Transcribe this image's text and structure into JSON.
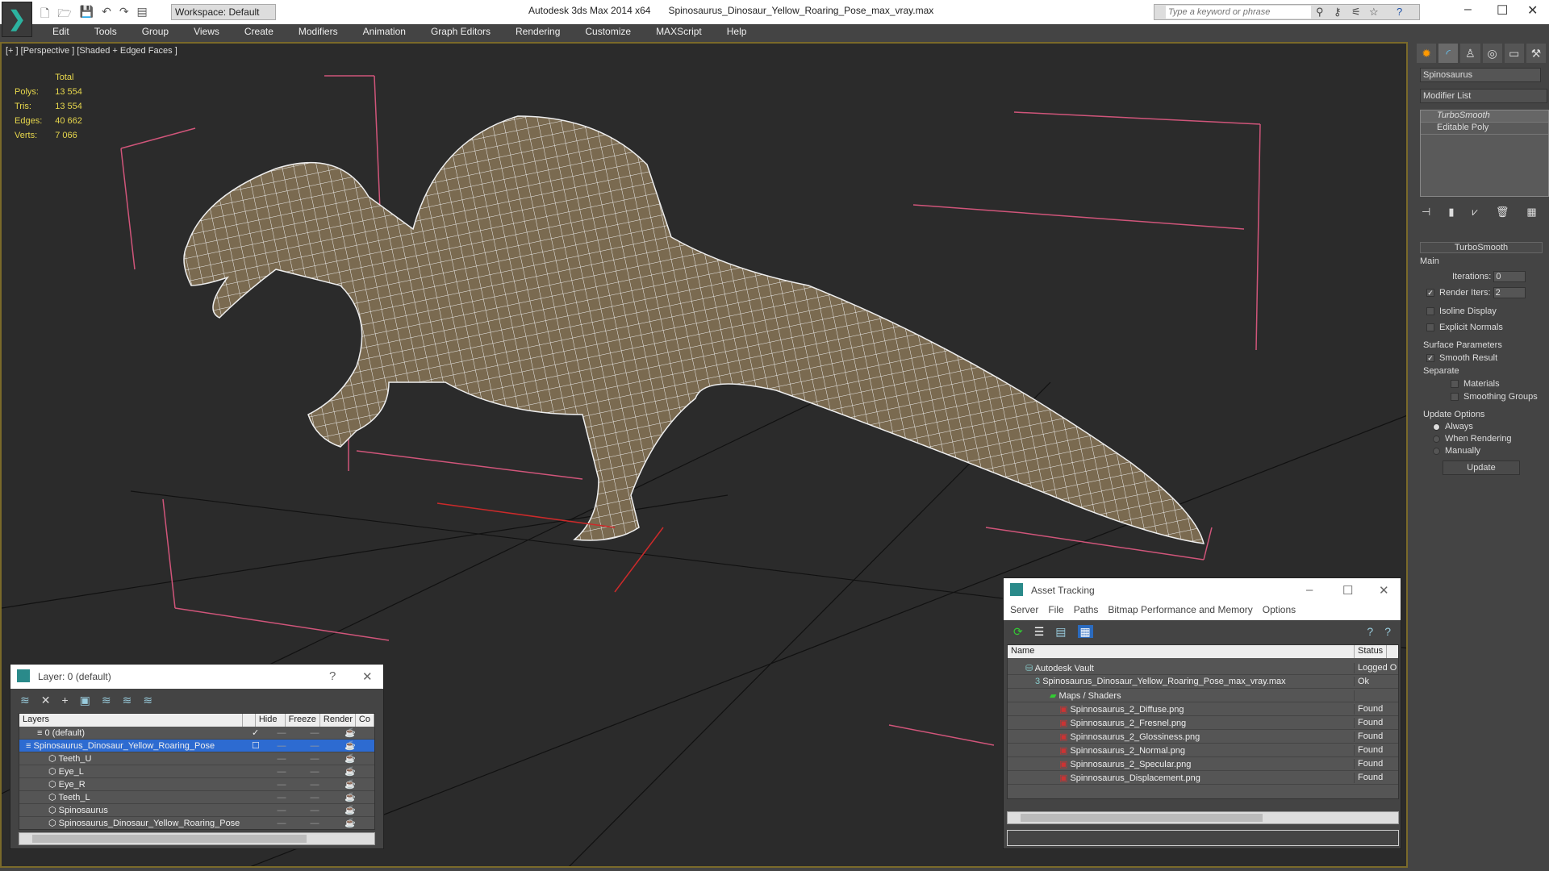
{
  "titlebar": {
    "workspace": "Workspace: Default",
    "app": "Autodesk 3ds Max  2014 x64",
    "file": "Spinosaurus_Dinosaur_Yellow_Roaring_Pose_max_vray.max",
    "search_placeholder": "Type a keyword or phrase"
  },
  "menu": [
    "Edit",
    "Tools",
    "Group",
    "Views",
    "Create",
    "Modifiers",
    "Animation",
    "Graph Editors",
    "Rendering",
    "Customize",
    "MAXScript",
    "Help"
  ],
  "viewport": {
    "label": "[+ ] [Perspective ] [Shaded + Edged Faces ]",
    "stats_header": "Total",
    "stats": [
      {
        "k": "Polys:",
        "v": "13 554"
      },
      {
        "k": "Tris:",
        "v": "13 554"
      },
      {
        "k": "Edges:",
        "v": "40 662"
      },
      {
        "k": "Verts:",
        "v": "7 066"
      }
    ]
  },
  "command_panel": {
    "object_name": "Spinosaurus",
    "modifier_list": "Modifier List",
    "stack": [
      "TurboSmooth",
      "Editable Poly"
    ],
    "rollout": "TurboSmooth",
    "main": "Main",
    "iterations_label": "Iterations:",
    "iterations": "0",
    "render_iters_label": "Render Iters:",
    "render_iters": "2",
    "isoline": "Isoline Display",
    "explicit": "Explicit Normals",
    "surface": "Surface Parameters",
    "smooth_result": "Smooth Result",
    "separate": "Separate",
    "materials": "Materials",
    "smoothing_groups": "Smoothing Groups",
    "update_options": "Update Options",
    "always": "Always",
    "when_rendering": "When Rendering",
    "manually": "Manually",
    "update": "Update"
  },
  "layer_dialog": {
    "title": "Layer: 0 (default)",
    "help": "?",
    "columns": [
      "Layers",
      "Hide",
      "Freeze",
      "Render",
      "Co"
    ],
    "rows": [
      {
        "name": "0 (default)",
        "indent": 1
      },
      {
        "name": "Spinosaurus_Dinosaur_Yellow_Roaring_Pose",
        "indent": 0
      },
      {
        "name": "Teeth_U",
        "indent": 2
      },
      {
        "name": "Eye_L",
        "indent": 2
      },
      {
        "name": "Eye_R",
        "indent": 2
      },
      {
        "name": "Teeth_L",
        "indent": 2
      },
      {
        "name": "Spinosaurus",
        "indent": 2
      },
      {
        "name": "Spinosaurus_Dinosaur_Yellow_Roaring_Pose",
        "indent": 2
      }
    ]
  },
  "asset_tracking": {
    "title": "Asset Tracking",
    "menu": [
      "Server",
      "File",
      "Paths",
      "Bitmap Performance and Memory",
      "Options"
    ],
    "columns": [
      "Name",
      "Status"
    ],
    "rows": [
      {
        "name": "Autodesk Vault",
        "status": "Logged O"
      },
      {
        "name": "Spinosaurus_Dinosaur_Yellow_Roaring_Pose_max_vray.max",
        "status": "Ok"
      },
      {
        "name": "Maps / Shaders",
        "status": ""
      },
      {
        "name": "Spinnosaurus_2_Diffuse.png",
        "status": "Found"
      },
      {
        "name": "Spinnosaurus_2_Fresnel.png",
        "status": "Found"
      },
      {
        "name": "Spinnosaurus_2_Glossiness.png",
        "status": "Found"
      },
      {
        "name": "Spinnosaurus_2_Normal.png",
        "status": "Found"
      },
      {
        "name": "Spinnosaurus_2_Specular.png",
        "status": "Found"
      },
      {
        "name": "Spinnosaurus_Displacement.png",
        "status": "Found"
      }
    ]
  }
}
